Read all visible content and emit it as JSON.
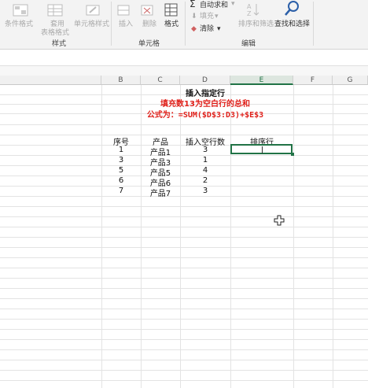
{
  "ribbon": {
    "cond_format": "条件格式",
    "table_format_1": "套用",
    "table_format_2": "表格格式",
    "cell_style": "单元格样式",
    "insert": "插入",
    "delete": "删除",
    "format": "格式",
    "autosum": "自动求和",
    "fill": "填充",
    "clear": "清除",
    "sort_filter": "排序和筛选",
    "find_select": "查找和选择",
    "group_styles": "样式",
    "group_cells": "单元格",
    "group_edit": "编辑"
  },
  "columns": [
    "B",
    "C",
    "D",
    "E",
    "F",
    "G"
  ],
  "sheet": {
    "title": "插入指定行",
    "subtitle": "填充数13为空白行的总和",
    "formula": "公式为：=SUM($D$3:D3)+$E$3",
    "headers": [
      "序号",
      "产品",
      "插入空行数",
      "排序行"
    ],
    "rows": [
      [
        "1",
        "产品1",
        "3"
      ],
      [
        "3",
        "产品3",
        "1"
      ],
      [
        "5",
        "产品5",
        "4"
      ],
      [
        "6",
        "产品6",
        "2"
      ],
      [
        "7",
        "产品7",
        "3"
      ]
    ]
  },
  "colors": {
    "red_text": "#e0201a",
    "accent": "#217346"
  }
}
